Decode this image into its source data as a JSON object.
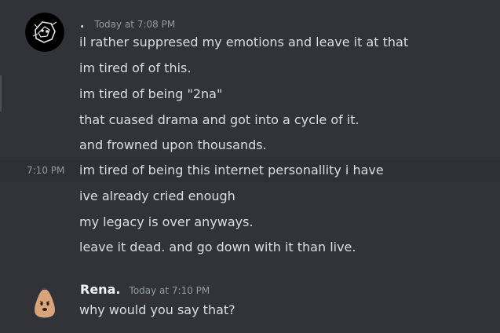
{
  "messages": [
    {
      "author": ".",
      "timestamp": "Today at 7:08 PM",
      "lines": [
        "il rather suppresed my emotions and leave it at that",
        "im tired of of this.",
        "im tired of being \"2na\"",
        "that cuased drama and got into a cycle of it.",
        "and frowned upon thousands.",
        "im tired of being this internet personallity i have",
        "ive already cried enough",
        "my legacy is over anyways.",
        "leave it dead. and go down with it than live."
      ],
      "hover_time": "7:10 PM"
    },
    {
      "author": "Rena.",
      "timestamp": "Today at 7:10 PM",
      "lines": [
        "why would you say that?"
      ]
    }
  ],
  "colors": {
    "background": "#313338",
    "text": "#dbdee1",
    "username": "#f2f3f5",
    "timestamp": "#949ba4"
  }
}
